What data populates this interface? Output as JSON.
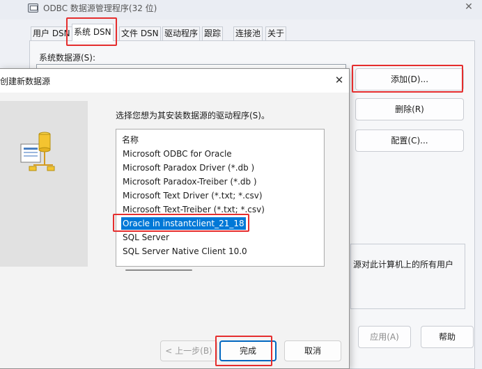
{
  "odbc": {
    "title": "ODBC 数据源管理程序(32 位)",
    "close": "✕",
    "tabs": [
      "用户 DSN",
      "系统 DSN",
      "文件 DSN",
      "驱动程序",
      "跟踪",
      "连接池",
      "关于"
    ],
    "active_tab": "系统 DSN",
    "system_ds_label": "系统数据源(S):",
    "buttons": {
      "add": "添加(D)...",
      "remove": "删除(R)",
      "configure": "配置(C)..."
    },
    "description_text": "源对此计算机上的所有用户",
    "bottom_buttons": {
      "apply": "应用(A)",
      "help": "帮助"
    }
  },
  "dialog": {
    "title": "创建新数据源",
    "close": "✕",
    "prompt": "选择您想为其安装数据源的驱动程序(S)。",
    "list_header": "名称",
    "drivers": [
      "Microsoft ODBC for Oracle",
      "Microsoft Paradox Driver (*.db )",
      "Microsoft Paradox-Treiber (*.db )",
      "Microsoft Text Driver (*.txt; *.csv)",
      "Microsoft Text-Treiber (*.txt; *.csv)",
      "Oracle in instantclient_21_18",
      "SQL Server",
      "SQL Server Native Client 10.0"
    ],
    "selected_driver": "Oracle in instantclient_21_18",
    "buttons": {
      "back": "< 上一步(B)",
      "finish": "完成",
      "cancel": "取消"
    }
  },
  "colors": {
    "highlight": "#e52d2d",
    "selection": "#0078d7",
    "accent": "#0067c0"
  }
}
